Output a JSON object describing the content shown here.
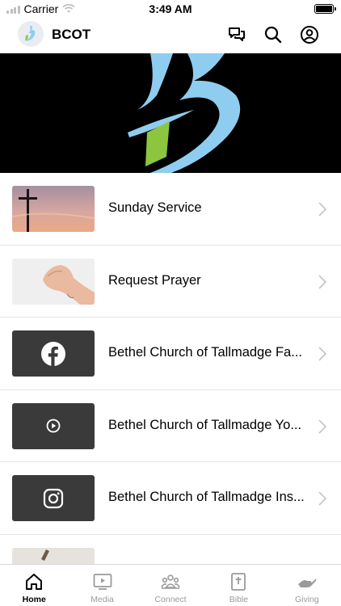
{
  "status_bar": {
    "carrier": "Carrier",
    "time": "3:49 AM"
  },
  "header": {
    "title": "BCOT",
    "icons": [
      "chat-icon",
      "search-icon",
      "account-icon"
    ]
  },
  "list": {
    "items": [
      {
        "label": "Sunday Service",
        "thumbnail": "cross-sunset-image"
      },
      {
        "label": "Request Prayer",
        "thumbnail": "praying-hands-image"
      },
      {
        "label": "Bethel Church of Tallmadge Fa...",
        "thumbnail": "facebook-icon"
      },
      {
        "label": "Bethel Church of Tallmadge Yo...",
        "thumbnail": "play-icon"
      },
      {
        "label": "Bethel Church of Tallmadge Ins...",
        "thumbnail": "instagram-icon"
      },
      {
        "label": "",
        "thumbnail": "partial-image"
      }
    ]
  },
  "tabs": [
    {
      "label": "Home",
      "icon": "home-icon",
      "active": true
    },
    {
      "label": "Media",
      "icon": "media-icon",
      "active": false
    },
    {
      "label": "Connect",
      "icon": "connect-icon",
      "active": false
    },
    {
      "label": "Bible",
      "icon": "bible-icon",
      "active": false
    },
    {
      "label": "Giving",
      "icon": "giving-icon",
      "active": false
    }
  ],
  "colors": {
    "brand_blue": "#8ecdf0",
    "brand_green": "#8cc63f",
    "tab_inactive": "#9a9a9a"
  }
}
